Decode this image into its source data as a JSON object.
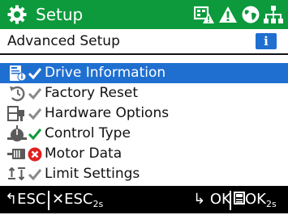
{
  "header": {
    "title": "Setup",
    "background": "#0c9a3c",
    "icons": [
      "gear-icon",
      "warning-sign-icon",
      "alert-triangle-icon",
      "globe-icon",
      "network-icon"
    ]
  },
  "subheader": {
    "title": "Advanced Setup",
    "info_label": "i"
  },
  "menu": {
    "accent": "#1f6fd1",
    "items": [
      {
        "label": "Drive Information",
        "icon": "drive-info-icon",
        "status": "ok",
        "selected": true
      },
      {
        "label": "Factory Reset",
        "icon": "reset-icon",
        "status": "ok",
        "selected": false
      },
      {
        "label": "Hardware Options",
        "icon": "hardware-icon",
        "status": "ok",
        "selected": false
      },
      {
        "label": "Control Type",
        "icon": "control-type-icon",
        "status": "ok-green",
        "selected": false
      },
      {
        "label": "Motor Data",
        "icon": "motor-icon",
        "status": "error",
        "selected": false
      },
      {
        "label": "Limit Settings",
        "icon": "limits-icon",
        "status": "ok",
        "selected": false
      }
    ]
  },
  "footer": {
    "esc_label": "ESC",
    "esc_long_label": "ESC",
    "esc_long_sub": "2s",
    "ok_label": "OK",
    "ok_long_label": "OK",
    "ok_long_sub": "2s"
  }
}
